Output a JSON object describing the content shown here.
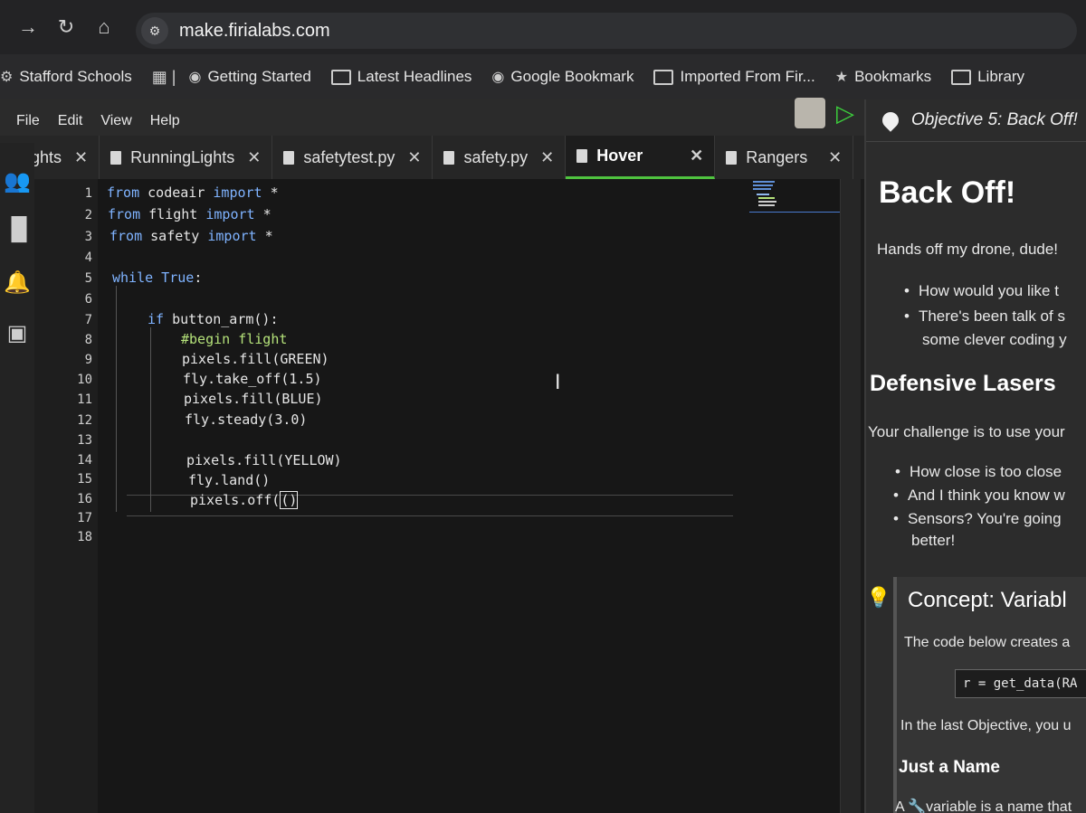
{
  "browser": {
    "url": "make.firialabs.com",
    "bookmarks": [
      {
        "label": "Stafford Schools",
        "icon": "gear-icon"
      },
      {
        "label": "Getting Started",
        "icon": "globe-icon"
      },
      {
        "label": "Latest Headlines",
        "icon": "folder-icon"
      },
      {
        "label": "Google Bookmark",
        "icon": "globe-icon"
      },
      {
        "label": "Imported From Fir...",
        "icon": "folder-icon"
      },
      {
        "label": "Bookmarks",
        "icon": "star-icon"
      },
      {
        "label": "Library",
        "icon": "folder-icon"
      }
    ]
  },
  "ide": {
    "menu": [
      "File",
      "Edit",
      "View",
      "Help"
    ],
    "tabs": [
      {
        "label": "ghts"
      },
      {
        "label": "RunningLights"
      },
      {
        "label": "safetytest.py"
      },
      {
        "label": "safety.py"
      },
      {
        "label": "Hover"
      },
      {
        "label": "Rangers"
      }
    ],
    "line_numbers": [
      "1",
      "2",
      "3",
      "4",
      "5",
      "6",
      "7",
      "8",
      "9",
      "10",
      "11",
      "12",
      "13",
      "14",
      "15",
      "16",
      "17",
      "18"
    ],
    "code": {
      "l1_kw1": "from",
      "l1_mod": " codeair ",
      "l1_kw2": "import",
      "l1_rest": " *",
      "l2_kw1": "from",
      "l2_mod": " flight ",
      "l2_kw2": "import",
      "l2_rest": " *",
      "l3_kw1": "from",
      "l3_mod": " safety ",
      "l3_kw2": "import",
      "l3_rest": " *",
      "l5_kw": "while",
      "l5_kw2": " True",
      "l5_rest": ":",
      "l7_kw": "if",
      "l7_rest": " button_arm():",
      "l8": "#begin flight",
      "l9": "pixels.fill(GREEN)",
      "l10": "fly.take_off(1.5)",
      "l11": "pixels.fill(BLUE)",
      "l12": "fly.steady(3.0)",
      "l14": "pixels.fill(YELLOW)",
      "l15": "fly.land()",
      "l16_a": "pixels.off(",
      "l16_b": ")"
    }
  },
  "panel": {
    "objective": "Objective 5: Back Off!",
    "title": "Back Off!",
    "intro": "Hands off my drone, dude!",
    "bullets1": [
      "How would you like t",
      "There's been talk of s"
    ],
    "bullets1_cont": "some clever coding y",
    "section": "Defensive Lasers",
    "challenge": "Your challenge is to use your",
    "bullets2": [
      "How close is too close",
      "And I think you know w",
      "Sensors? You're going"
    ],
    "bullets2_cont": "better!",
    "concept": "Concept: Variabl",
    "concept_text": "The code below creates a",
    "snippet": "r = get_data(RA",
    "last_obj": "In the last Objective, you u",
    "subhead": "Just a Name",
    "var_text": "A 🔧variable is a name that"
  }
}
